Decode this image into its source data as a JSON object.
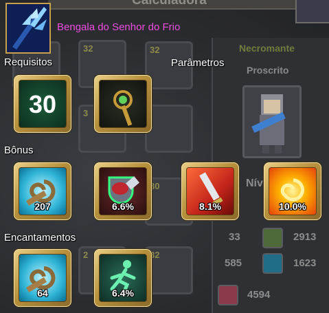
{
  "window": {
    "title": "Calculadora"
  },
  "item": {
    "name": "Bengala do Senhor do Frio",
    "name_color": "#f04de0"
  },
  "sections": {
    "requirements": "Requisitos",
    "parameters": "Parâmetros",
    "bonus": "Bônus",
    "enchantments": "Encantamentos"
  },
  "requirements": {
    "level": "30",
    "icon": "staff-icon"
  },
  "bonus": [
    {
      "icon": "swirl-scroll-icon",
      "value": "207"
    },
    {
      "icon": "shield-potion-icon",
      "value": "6.6%"
    },
    {
      "icon": "sword-slash-icon",
      "value": "8.1%"
    },
    {
      "icon": "fire-swirl-icon",
      "value": "10.0%"
    }
  ],
  "enchantments": [
    {
      "icon": "swirl-scroll-icon",
      "value": "64"
    },
    {
      "icon": "running-figure-icon",
      "value": "6.4%"
    }
  ],
  "background_slots": [
    "32",
    "32",
    "32",
    "3",
    "30",
    "2",
    "32"
  ],
  "character": {
    "class": "Necromante",
    "subclass": "Proscrito",
    "level_prefix": "Nív",
    "stats": [
      {
        "left": "33",
        "icon": "figure-icon",
        "right": "2913"
      },
      {
        "left": "585",
        "icon": "vortex-icon",
        "right": "1623"
      },
      {
        "left": "",
        "icon": "health-icon",
        "right": "4594"
      }
    ]
  },
  "colors": {
    "gold_frame": "#c9a14a",
    "class_green": "#6e7d3c"
  }
}
